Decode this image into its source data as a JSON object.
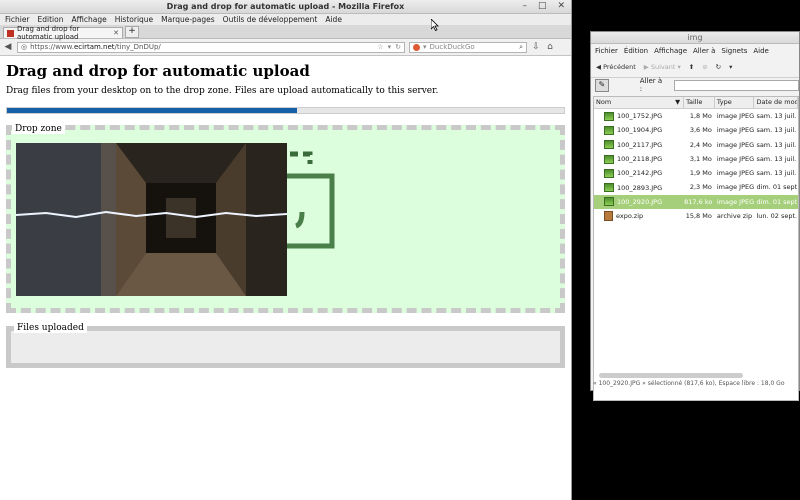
{
  "firefox": {
    "window_title": "Drag and drop for automatic upload - Mozilla Firefox",
    "menu": [
      "Fichier",
      "Edition",
      "Affichage",
      "Historique",
      "Marque-pages",
      "Outils de développement",
      "Aide"
    ],
    "tab_title": "Drag and drop for automatic upload",
    "url_scheme": "https://www.",
    "url_host": "ecirtam.net",
    "url_path": "/tiny_DnDUp/",
    "search_placeholder": "DuckDuckGo"
  },
  "page": {
    "heading": "Drag and drop for automatic upload",
    "description": "Drag files from your desktop on to the drop zone. Files are upload automatically to this server.",
    "progress_fraction": 0.52,
    "drop_zone_legend": "Drop zone",
    "files_uploaded_legend": "Files uploaded"
  },
  "file_manager": {
    "title": "img",
    "menu": [
      "Fichier",
      "Édition",
      "Affichage",
      "Aller à",
      "Signets",
      "Aide"
    ],
    "toolbar": {
      "back": "Précédent",
      "forward": "Suivant"
    },
    "go_label": "Aller à :",
    "columns": [
      "Nom",
      "Taille",
      "Type",
      "Date de modif"
    ],
    "files": [
      {
        "name": "100_1752.JPG",
        "size": "1,8 Mo",
        "type": "image JPEG",
        "date": "sam. 13 juil. 2"
      },
      {
        "name": "100_1904.JPG",
        "size": "3,6 Mo",
        "type": "image JPEG",
        "date": "sam. 13 juil. 2"
      },
      {
        "name": "100_2117.JPG",
        "size": "2,4 Mo",
        "type": "image JPEG",
        "date": "sam. 13 juil. 2"
      },
      {
        "name": "100_2118.JPG",
        "size": "3,1 Mo",
        "type": "image JPEG",
        "date": "sam. 13 juil. 2"
      },
      {
        "name": "100_2142.JPG",
        "size": "1,9 Mo",
        "type": "image JPEG",
        "date": "sam. 13 juil. 2"
      },
      {
        "name": "100_2893.JPG",
        "size": "2,3 Mo",
        "type": "image JPEG",
        "date": "dim. 01 sept."
      },
      {
        "name": "100_2920.JPG",
        "size": "817,6 ko",
        "type": "image JPEG",
        "date": "dim. 01 sept."
      },
      {
        "name": "expo.zip",
        "size": "15,8 Mo",
        "type": "archive zip",
        "date": "lun. 02 sept. 2"
      }
    ],
    "selected_index": 6,
    "status": "« 100_2920.JPG » sélectionné (817,6 ko), Espace libre : 18,0 Go"
  }
}
